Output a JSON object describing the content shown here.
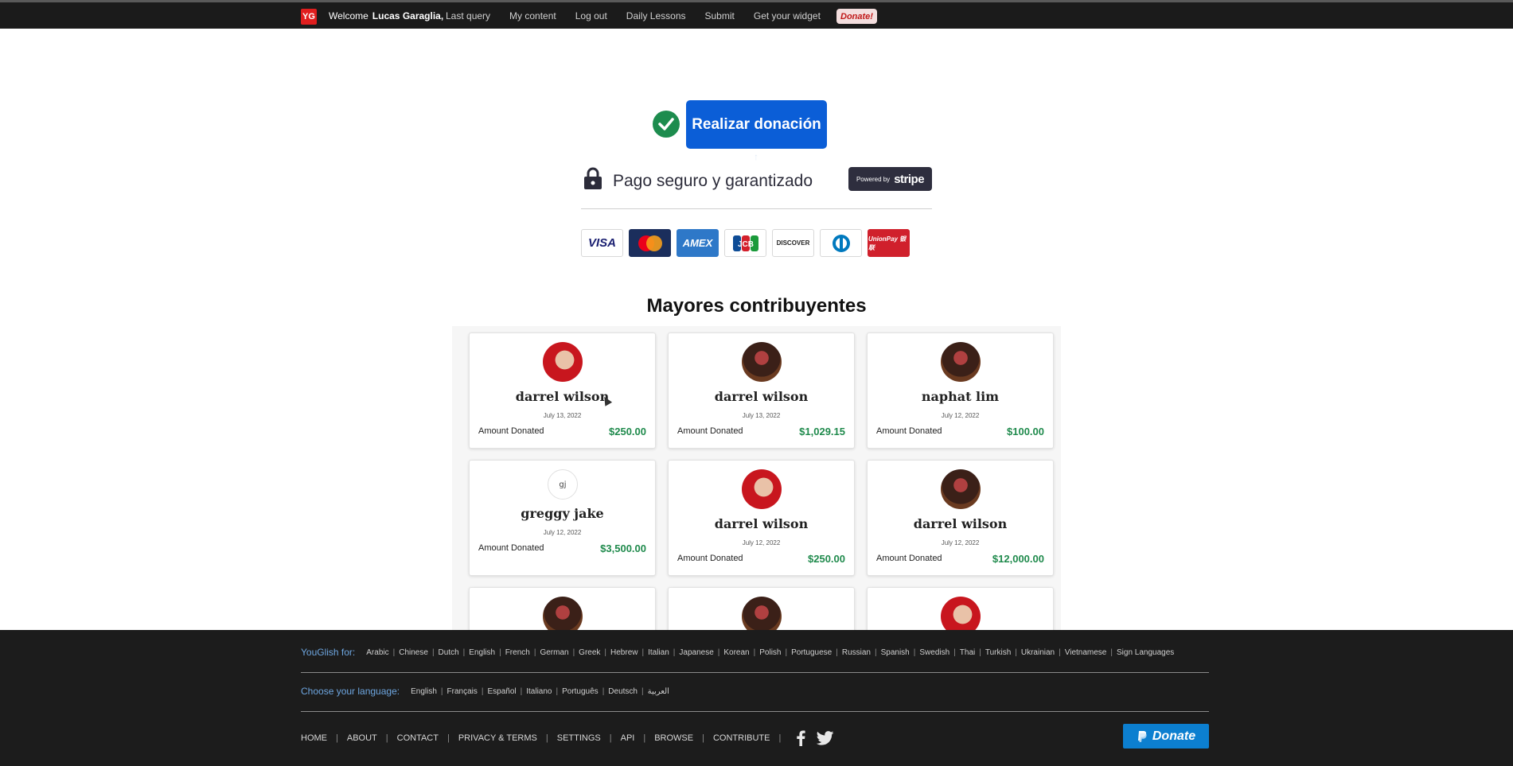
{
  "topnav": {
    "logo": "YG",
    "welcome": "Welcome",
    "user": "Lucas Garaglia,",
    "links": [
      "Last query",
      "My content",
      "Log out",
      "Daily Lessons",
      "Submit",
      "Get your widget"
    ],
    "donate": "Donate!"
  },
  "donation": {
    "button_label": "Realizar donación",
    "secure_text": "Pago seguro y garantizado",
    "stripe_powered": "Powered by",
    "stripe_brand": "stripe",
    "cards": [
      "visa",
      "mastercard",
      "amex",
      "jcb",
      "discover",
      "diners",
      "unionpay"
    ],
    "card_labels": {
      "visa": "VISA",
      "amex": "AMEX",
      "jcb": "JCB",
      "discover": "DISCOVER",
      "unionpay": "UnionPay 银联"
    }
  },
  "contributors": {
    "heading": "Mayores contribuyentes",
    "amount_label": "Amount Donated",
    "items": [
      {
        "name": "darrel wilson",
        "date": "July 13, 2022",
        "amount": "$250.00",
        "avatar": "red"
      },
      {
        "name": "darrel wilson",
        "date": "July 13, 2022",
        "amount": "$1,029.15",
        "avatar": "dark"
      },
      {
        "name": "naphat lim",
        "date": "July 12, 2022",
        "amount": "$100.00",
        "avatar": "dark"
      },
      {
        "name": "greggy jake",
        "date": "July 12, 2022",
        "amount": "$3,500.00",
        "avatar": "initials",
        "initials": "gj"
      },
      {
        "name": "darrel wilson",
        "date": "July 12, 2022",
        "amount": "$250.00",
        "avatar": "red"
      },
      {
        "name": "darrel wilson",
        "date": "July 12, 2022",
        "amount": "$12,000.00",
        "avatar": "dark"
      }
    ]
  },
  "footer": {
    "youglish_label": "YouGlish for:",
    "languages": [
      "Arabic",
      "Chinese",
      "Dutch",
      "English",
      "French",
      "German",
      "Greek",
      "Hebrew",
      "Italian",
      "Japanese",
      "Korean",
      "Polish",
      "Portuguese",
      "Russian",
      "Spanish",
      "Swedish",
      "Thai",
      "Turkish",
      "Ukrainian",
      "Vietnamese",
      "Sign Languages"
    ],
    "choose_label": "Choose your language:",
    "ui_languages": [
      "English",
      "Français",
      "Español",
      "Italiano",
      "Português",
      "Deutsch",
      "العربية"
    ],
    "menu": [
      "HOME",
      "ABOUT",
      "CONTACT",
      "PRIVACY & TERMS",
      "SETTINGS",
      "API",
      "BROWSE",
      "CONTRIBUTE"
    ],
    "paypal_donate": "Donate"
  },
  "colors": {
    "nav_bg": "#1b1b1b",
    "primary_button": "#0b5ed7",
    "amount_green": "#1f8a4c",
    "footer_bg": "#1c1c1c",
    "footer_label": "#6ea6e0",
    "paypal": "#0c7fd0"
  }
}
